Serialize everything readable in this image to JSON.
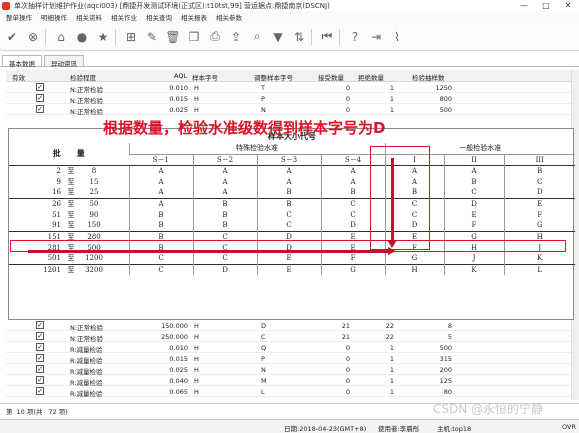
{
  "window": {
    "title": "单次抽样计划维护作业(aqci003)     [鼎捷开发测试环境(正式区):t10tst,99]     营运据点:鼎捷南京(DSCNJ)",
    "controls": [
      "—",
      "□",
      "✕"
    ]
  },
  "menu": [
    "整单操作",
    "明细操作",
    "相关资料",
    "相关作业",
    "相关查询",
    "相关报表",
    "相关参数"
  ],
  "toolbar": [
    {
      "name": "confirm-icon",
      "glyph": "✔"
    },
    {
      "name": "cancel-icon",
      "glyph": "⊗"
    },
    {
      "name": "home-icon",
      "glyph": "⌂"
    },
    {
      "name": "location-icon",
      "glyph": "●"
    },
    {
      "name": "star-icon",
      "glyph": "★"
    },
    {
      "name": "new-icon",
      "glyph": "⊞"
    },
    {
      "name": "edit-icon",
      "glyph": "✎"
    },
    {
      "name": "delete-icon",
      "glyph": "🗑"
    },
    {
      "name": "copy-icon",
      "glyph": "❐"
    },
    {
      "name": "print-icon",
      "glyph": "⎙"
    },
    {
      "name": "export-icon",
      "glyph": "⇪"
    },
    {
      "name": "search-icon",
      "glyph": "⌕"
    },
    {
      "name": "filter-icon",
      "glyph": "▼"
    },
    {
      "name": "sort-icon",
      "glyph": "⇅"
    },
    {
      "name": "first-icon",
      "glyph": "⏮"
    },
    {
      "name": "help-icon",
      "glyph": "?"
    },
    {
      "name": "exit-icon",
      "glyph": "⇥"
    },
    {
      "name": "attach-icon",
      "glyph": "⌇"
    }
  ],
  "tabs": [
    "基本数据",
    "异动资讯"
  ],
  "grid": {
    "headers": [
      "有效",
      "检验程度",
      "AQL",
      "样本字号",
      "调整样本字号",
      "接受数量",
      "拒绝数量",
      "检验抽样数"
    ],
    "top_rows": [
      {
        "level": "N:正常检验",
        "aql": "0.010",
        "code": "H",
        "adj": "T",
        "acc": "0",
        "rej": "1",
        "n": "1250"
      },
      {
        "level": "N:正常检验",
        "aql": "0.015",
        "code": "H",
        "adj": "P",
        "acc": "0",
        "rej": "1",
        "n": "800"
      },
      {
        "level": "N:正常检验",
        "aql": "0.025",
        "code": "H",
        "adj": "N",
        "acc": "0",
        "rej": "1",
        "n": "500"
      }
    ],
    "bottom_rows": [
      {
        "level": "N:正常检验",
        "aql": "150.000",
        "code": "H",
        "adj": "D",
        "acc": "21",
        "rej": "22",
        "n": "8"
      },
      {
        "level": "N:正常检验",
        "aql": "250.000",
        "code": "H",
        "adj": "C",
        "acc": "21",
        "rej": "22",
        "n": "5"
      },
      {
        "level": "R:减量检验",
        "aql": "0.010",
        "code": "H",
        "adj": "Q",
        "acc": "0",
        "rej": "1",
        "n": "500"
      },
      {
        "level": "R:减量检验",
        "aql": "0.015",
        "code": "H",
        "adj": "P",
        "acc": "0",
        "rej": "1",
        "n": "315"
      },
      {
        "level": "R:减量检验",
        "aql": "0.025",
        "code": "H",
        "adj": "N",
        "acc": "0",
        "rej": "1",
        "n": "200"
      },
      {
        "level": "R:减量检验",
        "aql": "0.040",
        "code": "H",
        "adj": "M",
        "acc": "0",
        "rej": "1",
        "n": "125"
      },
      {
        "level": "R:减量检验",
        "aql": "0.065",
        "code": "H",
        "adj": "L",
        "acc": "0",
        "rej": "1",
        "n": "80"
      }
    ]
  },
  "overlay": {
    "title": "样本大小代号",
    "annotation": "根据数量，检验水准级数得到样本字号为D",
    "header1": [
      "批　　量",
      "特殊检验水准",
      "一般检验水准"
    ],
    "header2": [
      "S－1",
      "S－2",
      "S－3",
      "S－4",
      "I",
      "II",
      "III"
    ],
    "rows": [
      {
        "lot": [
          "2",
          "至",
          "8"
        ],
        "codes": [
          "A",
          "A",
          "A",
          "A",
          "A",
          "A",
          "B"
        ],
        "sep": true
      },
      {
        "lot": [
          "9",
          "至",
          "15"
        ],
        "codes": [
          "A",
          "A",
          "A",
          "A",
          "A",
          "B",
          "C"
        ],
        "sep": false
      },
      {
        "lot": [
          "16",
          "至",
          "25"
        ],
        "codes": [
          "A",
          "A",
          "B",
          "B",
          "B",
          "C",
          "D"
        ],
        "sep": false
      },
      {
        "lot": [
          "26",
          "至",
          "50"
        ],
        "codes": [
          "A",
          "B",
          "B",
          "C",
          "C",
          "D",
          "E"
        ],
        "sep": true
      },
      {
        "lot": [
          "51",
          "至",
          "90"
        ],
        "codes": [
          "B",
          "B",
          "C",
          "C",
          "C",
          "E",
          "F"
        ],
        "sep": false
      },
      {
        "lot": [
          "91",
          "至",
          "150"
        ],
        "codes": [
          "B",
          "B",
          "C",
          "D",
          "D",
          "F",
          "G"
        ],
        "sep": false
      },
      {
        "lot": [
          "151",
          "至",
          "280"
        ],
        "codes": [
          "B",
          "C",
          "D",
          "E",
          "E",
          "G",
          "H"
        ],
        "sep": true
      },
      {
        "lot": [
          "281",
          "至",
          "500"
        ],
        "codes": [
          "B",
          "C",
          "D",
          "E",
          "F",
          "H",
          "J"
        ],
        "sep": false
      },
      {
        "lot": [
          "501",
          "至",
          "1200"
        ],
        "codes": [
          "C",
          "C",
          "E",
          "F",
          "G",
          "J",
          "K"
        ],
        "sep": false
      },
      {
        "lot": [
          "1201",
          "至",
          "3200"
        ],
        "codes": [
          "C",
          "D",
          "E",
          "G",
          "H",
          "K",
          "L"
        ],
        "sep": true
      }
    ]
  },
  "status": {
    "page": "第",
    "record": "10 项(共",
    "total": "72 项)"
  },
  "footer": {
    "date": "日期:2018-04-23(GMT+8)",
    "user": "使用者:李晨彤",
    "host": "主机:top18",
    "ovr": "OVR"
  },
  "watermark": "CSDN @永恒的宁静"
}
